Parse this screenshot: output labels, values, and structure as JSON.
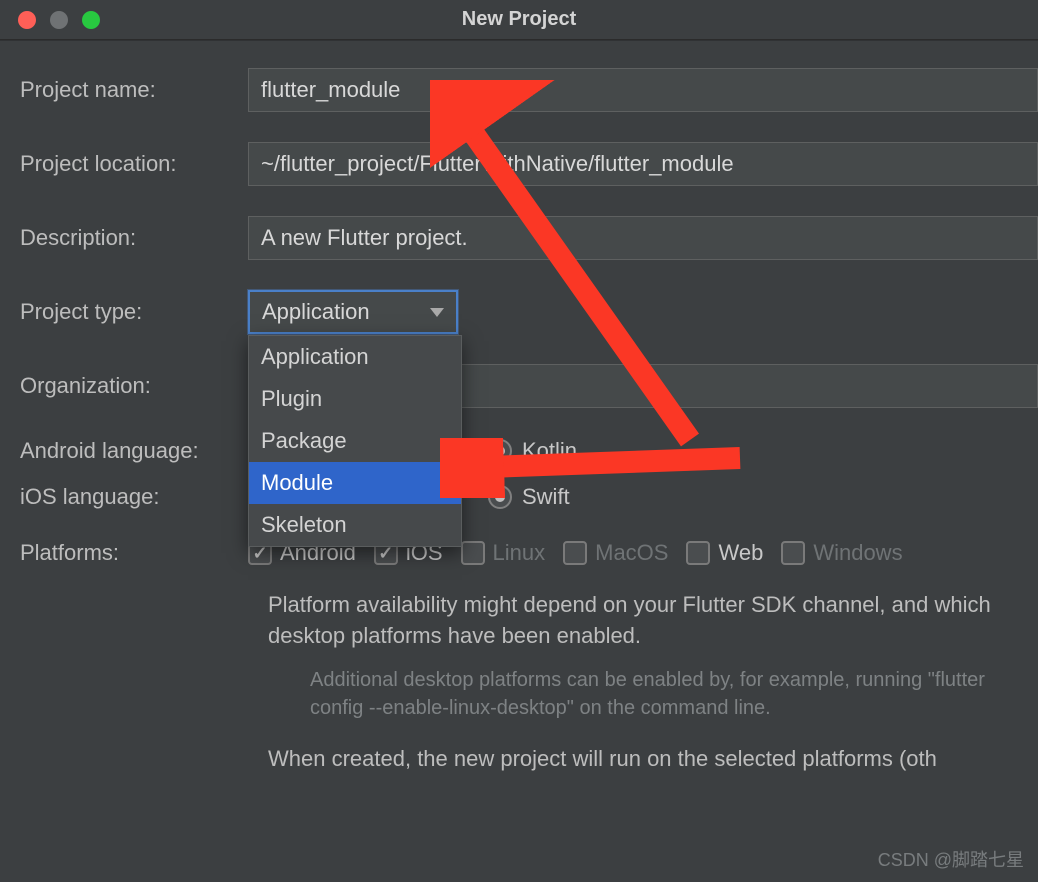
{
  "window": {
    "title": "New Project"
  },
  "fields": {
    "project_name": {
      "label": "Project name:",
      "value": "flutter_module"
    },
    "project_location": {
      "label": "Project location:",
      "value": "~/flutter_project/FlutterWithNative/flutter_module"
    },
    "description": {
      "label": "Description:",
      "value": "A new Flutter project."
    },
    "project_type": {
      "label": "Project type:",
      "selected": "Application",
      "options": [
        "Application",
        "Plugin",
        "Package",
        "Module",
        "Skeleton"
      ],
      "highlighted": "Module"
    },
    "organization": {
      "label": "Organization:",
      "value": ""
    },
    "android_language": {
      "label": "Android language:",
      "options": [
        {
          "label": "Kotlin",
          "checked": true
        }
      ]
    },
    "ios_language": {
      "label": "iOS language:",
      "options": [
        {
          "label": "Swift",
          "checked": true
        }
      ]
    },
    "platforms": {
      "label": "Platforms:",
      "options": [
        {
          "label": "Android",
          "checked": true,
          "enabled": true
        },
        {
          "label": "iOS",
          "checked": true,
          "enabled": true
        },
        {
          "label": "Linux",
          "checked": false,
          "enabled": false
        },
        {
          "label": "MacOS",
          "checked": false,
          "enabled": false
        },
        {
          "label": "Web",
          "checked": false,
          "enabled": true
        },
        {
          "label": "Windows",
          "checked": false,
          "enabled": false
        }
      ]
    }
  },
  "info": {
    "line1": "Platform availability might depend on your Flutter SDK channel, and which desktop platforms have been enabled.",
    "line2": "Additional desktop platforms can be enabled by, for example, running \"flutter config --enable-linux-desktop\" on the command line.",
    "line3": "When created, the new project will run on the selected platforms (oth"
  },
  "watermark": "CSDN @脚踏七星",
  "colors": {
    "accent": "#2f65ca",
    "arrow": "#fb3725"
  }
}
